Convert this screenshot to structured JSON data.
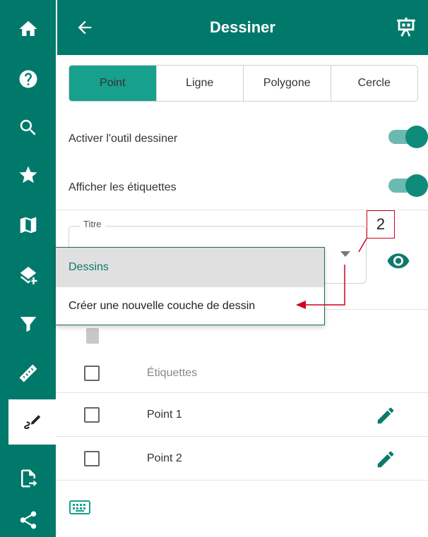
{
  "rail": {
    "items": [
      {
        "icon": "home-icon"
      },
      {
        "icon": "help-icon"
      },
      {
        "icon": "search-icon"
      },
      {
        "icon": "star-icon"
      },
      {
        "icon": "map-icon"
      },
      {
        "icon": "layers-add-icon"
      },
      {
        "icon": "filter-icon"
      },
      {
        "icon": "ruler-icon"
      },
      {
        "icon": "draw-icon",
        "active": true
      },
      {
        "icon": "file-export-icon"
      },
      {
        "icon": "share-icon"
      }
    ]
  },
  "header": {
    "title": "Dessiner",
    "back_icon": "arrow-left-icon",
    "right_icon": "presentation-icon"
  },
  "tabs": [
    {
      "label": "Point",
      "selected": true
    },
    {
      "label": "Ligne"
    },
    {
      "label": "Polygone"
    },
    {
      "label": "Cercle"
    }
  ],
  "settings": {
    "activate_draw": {
      "label": "Activer l'outil dessiner",
      "on": true
    },
    "show_labels": {
      "label": "Afficher les étiquettes",
      "on": true
    }
  },
  "title_field": {
    "legend": "Titre",
    "options": [
      "Dessins",
      "Créer une nouvelle couche de dessin"
    ],
    "highlighted_option": "Dessins"
  },
  "annotation": {
    "number": "2",
    "color": "#d0021b"
  },
  "list": {
    "header": {
      "label": "Étiquettes"
    },
    "items": [
      {
        "label": "Point 1"
      },
      {
        "label": "Point 2"
      }
    ]
  },
  "colors": {
    "primary": "#00796b",
    "tab_selected": "#17a08c",
    "toggle_knob": "#0f8b7a",
    "toggle_track": "#6bbab0",
    "dropdown_highlight": "#e0e0e0"
  }
}
